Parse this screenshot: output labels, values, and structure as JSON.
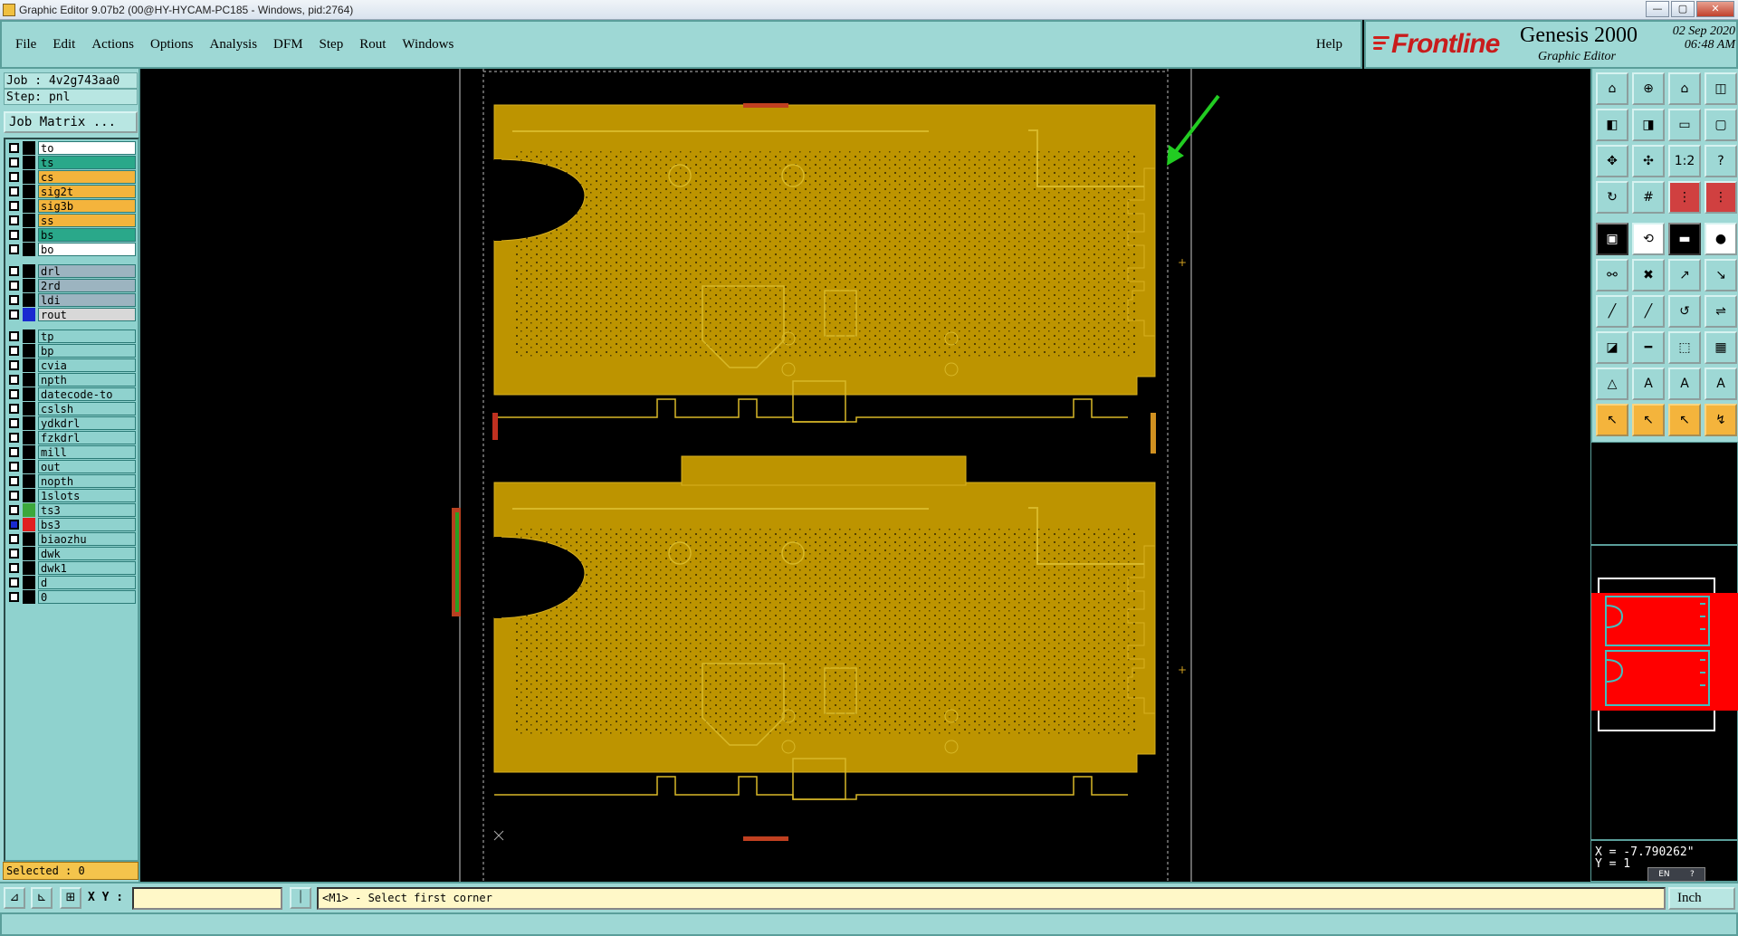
{
  "window": {
    "title": "Graphic Editor 9.07b2 (00@HY-HYCAM-PC185 - Windows, pid:2764)",
    "controls": [
      "—",
      "▢",
      "✕"
    ]
  },
  "menu": {
    "items": [
      "File",
      "Edit",
      "Actions",
      "Options",
      "Analysis",
      "DFM",
      "Step",
      "Rout",
      "Windows"
    ],
    "help": "Help"
  },
  "brand": {
    "logo_text": "Frontline",
    "product": "Genesis 2000",
    "subproduct": "Graphic Editor",
    "date": "02 Sep 2020",
    "time": "06:48 AM"
  },
  "job": {
    "job_line": "Job : 4v2g743aa0",
    "step_line": "Step: pnl",
    "matrix_button": "Job Matrix ..."
  },
  "layers": [
    {
      "name": "to",
      "color": "#ffffff",
      "swatch": "#000000",
      "active": false
    },
    {
      "name": "ts",
      "color": "#2aa88a",
      "swatch": "#000000",
      "active": false
    },
    {
      "name": "cs",
      "color": "#f4b43c",
      "swatch": "#000000",
      "active": false
    },
    {
      "name": "sig2t",
      "color": "#f4b43c",
      "swatch": "#000000",
      "active": false
    },
    {
      "name": "sig3b",
      "color": "#f4b43c",
      "swatch": "#000000",
      "active": false
    },
    {
      "name": "ss",
      "color": "#f4b43c",
      "swatch": "#000000",
      "active": false
    },
    {
      "name": "bs",
      "color": "#2aa88a",
      "swatch": "#000000",
      "active": false
    },
    {
      "name": "bo",
      "color": "#ffffff",
      "swatch": "#000000",
      "active": false
    },
    {
      "name": "drl",
      "color": "#9cb4c0",
      "swatch": "#000000",
      "active": false
    },
    {
      "name": "2rd",
      "color": "#9cb4c0",
      "swatch": "#000000",
      "active": false
    },
    {
      "name": "ldi",
      "color": "#9cb4c0",
      "swatch": "#000000",
      "active": false
    },
    {
      "name": "rout",
      "color": "#d8d8d8",
      "swatch": "#1a2ad0",
      "active": false
    },
    {
      "name": "tp",
      "color": "#8fd2ce",
      "swatch": "#000000",
      "active": false
    },
    {
      "name": "bp",
      "color": "#8fd2ce",
      "swatch": "#000000",
      "active": false
    },
    {
      "name": "cvia",
      "color": "#8fd2ce",
      "swatch": "#000000",
      "active": false
    },
    {
      "name": "npth",
      "color": "#8fd2ce",
      "swatch": "#000000",
      "active": false
    },
    {
      "name": "datecode-to",
      "color": "#8fd2ce",
      "swatch": "#000000",
      "active": false
    },
    {
      "name": "cslsh",
      "color": "#8fd2ce",
      "swatch": "#000000",
      "active": false
    },
    {
      "name": "ydkdrl",
      "color": "#8fd2ce",
      "swatch": "#000000",
      "active": false
    },
    {
      "name": "fzkdrl",
      "color": "#8fd2ce",
      "swatch": "#000000",
      "active": false
    },
    {
      "name": "mill",
      "color": "#8fd2ce",
      "swatch": "#000000",
      "active": false
    },
    {
      "name": "out",
      "color": "#8fd2ce",
      "swatch": "#000000",
      "active": false
    },
    {
      "name": "nopth",
      "color": "#8fd2ce",
      "swatch": "#000000",
      "active": false
    },
    {
      "name": "1slots",
      "color": "#8fd2ce",
      "swatch": "#000000",
      "active": false
    },
    {
      "name": "ts3",
      "color": "#8fd2ce",
      "swatch": "#3ca83c",
      "active": false
    },
    {
      "name": "bs3",
      "color": "#8fd2ce",
      "swatch": "#e02020",
      "active": true
    },
    {
      "name": "biaozhu",
      "color": "#8fd2ce",
      "swatch": "#000000",
      "active": false
    },
    {
      "name": "dwk",
      "color": "#8fd2ce",
      "swatch": "#000000",
      "active": false
    },
    {
      "name": "dwk1",
      "color": "#8fd2ce",
      "swatch": "#000000",
      "active": false
    },
    {
      "name": "d",
      "color": "#8fd2ce",
      "swatch": "#000000",
      "active": false
    },
    {
      "name": "0",
      "color": "#8fd2ce",
      "swatch": "#000000",
      "active": false
    }
  ],
  "status": {
    "selected": "Selected : 0",
    "xy_label": "X Y :",
    "xy_value": "",
    "prompt": "<M1> - Select first corner",
    "units": "Inch",
    "x_readout": "X = -7.790262\"",
    "y_readout": "Y = 1"
  },
  "ime": {
    "lang": "EN",
    "help": "?"
  },
  "colors": {
    "panel": "#9ed8d5",
    "board": "#bd9400",
    "board_detail": "#000000",
    "arrow": "#22cc22",
    "minimap_fill": "#ff0000",
    "minimap_outline": "#40c0c0"
  }
}
